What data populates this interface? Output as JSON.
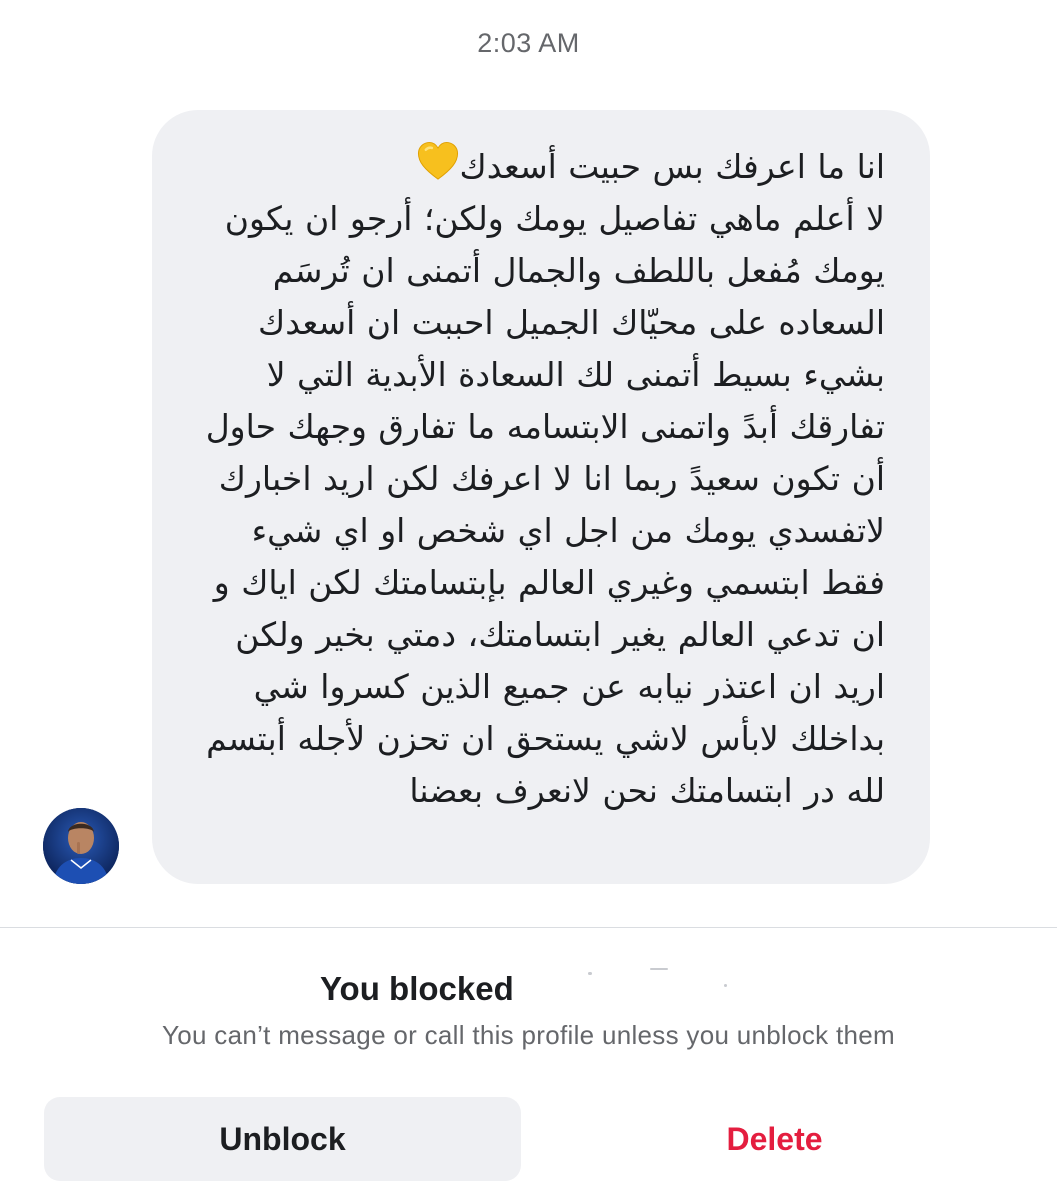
{
  "conversation": {
    "timestamp": "2:03 AM",
    "message": {
      "first_line": "انا ما اعرفك بس حبيت أسعدك",
      "emoji_icon": "yellow-heart-icon",
      "body": "لا أعلم ماهي تفاصيل يومك ولكن؛ أرجو ان يكون يومك مُفعل باللطف والجمال أتمنى ان تُرسَم السعاده على محيّاك الجميل احببت ان أسعدك بشيء بسيط أتمنى لك السعادة الأبدية التي لا تفارقك أبدً واتمنى الابتسامه ما تفارق وجهك حاول أن تكون سعيدً ربما انا لا اعرفك لكن اريد اخبارك لاتفسدي يومك من اجل اي شخص او اي شيء  فقط ابتسمي وغيري العالم بإبتسامتك لكن اياك و ان تدعي العالم يغير ابتسامتك، دمتي بخير  ولكن اريد ان اعتذر نيابه عن جميع الذين كسروا شي بداخلك لابأس لاشي يستحق ان تحزن لأجله أبتسم لله در ابتسامتك نحن لانعرف بعضنا"
    }
  },
  "blocked_notice": {
    "title": "You blocked",
    "subtitle": "You can’t message or call this profile unless you unblock them"
  },
  "actions": {
    "unblock_label": "Unblock",
    "delete_label": "Delete"
  },
  "colors": {
    "bubble_bg": "#eff0f3",
    "delete_red": "#e41e3f",
    "secondary_text": "#65676b"
  }
}
